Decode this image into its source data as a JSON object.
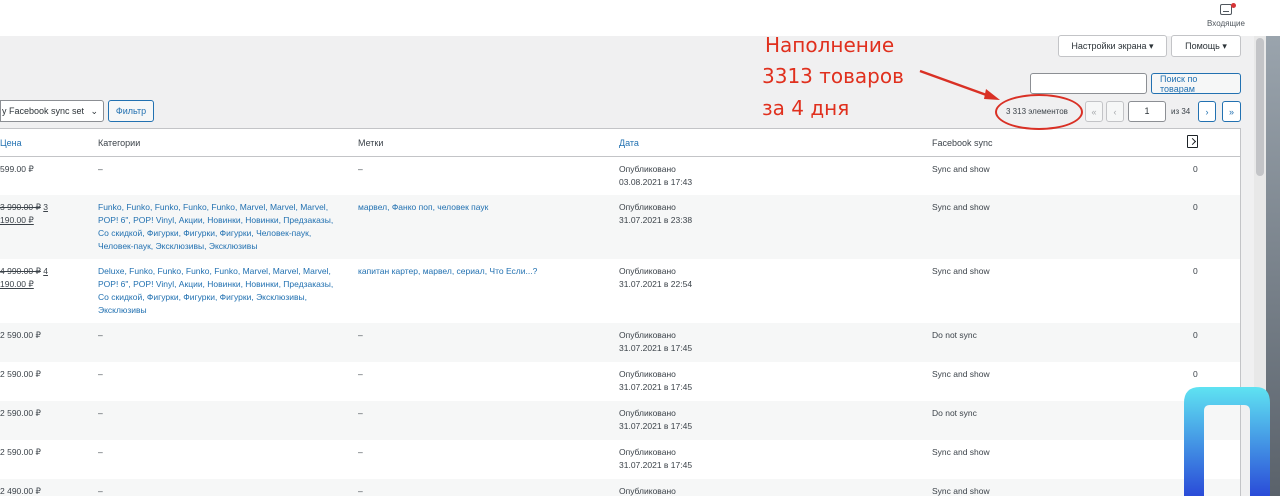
{
  "topbar": {
    "inbox_label": "Входящие"
  },
  "screen_options": {
    "settings_label": "Настройки экрана ▾",
    "help_label": "Помощь ▾"
  },
  "search": {
    "button_label": "Поиск по товарам",
    "value": ""
  },
  "filters": {
    "sync_select_value": "y Facebook sync set",
    "filter_button_label": "Фильтр"
  },
  "pagination": {
    "count_label": "3 313 элементов",
    "first": "«",
    "prev": "‹",
    "current_page": "1",
    "of_label": "из 34",
    "next": "›",
    "last": "»"
  },
  "annotation": {
    "line1": "Наполнение",
    "line2": "3313 товаров",
    "line3": "за 4 дня",
    "color": "#e0301e"
  },
  "table": {
    "headers": {
      "price": "Цена",
      "categories": "Категории",
      "tags": "Метки",
      "date": "Дата",
      "fb_sync": "Facebook sync"
    },
    "rows": [
      {
        "price_line1": "599.00 ₽",
        "price_line2": "",
        "categories": "–",
        "tags": "–",
        "date_status": "Опубликовано",
        "date_value": "03.08.2021 в 17:43",
        "fb": "Sync and show",
        "count": "0"
      },
      {
        "price_old": "3 990.00 ₽",
        "price_line1": "3",
        "price_line2": "190.00 ₽",
        "categories": [
          "Funko, Funko, Funko, Funko, Funko, Marvel, Marvel, Marvel,",
          "POP! 6\", POP! Vinyl, Акции, Новинки, Новинки, Предзаказы,",
          "Со скидкой, Фигурки, Фигурки, Фигурки, Человек-паук,",
          "Человек-паук, Эксклюзивы, Эксклюзивы"
        ],
        "tags": "марвел, Фанко поп, человек паук",
        "date_status": "Опубликовано",
        "date_value": "31.07.2021 в 23:38",
        "fb": "Sync and show",
        "count": "0"
      },
      {
        "price_old": "4 990.00 ₽",
        "price_line1": "4",
        "price_line2": "190.00 ₽",
        "categories": [
          "Deluxe, Funko, Funko, Funko, Funko, Marvel, Marvel, Marvel,",
          "POP! 6\", POP! Vinyl, Акции, Новинки, Новинки, Предзаказы,",
          "Со скидкой, Фигурки, Фигурки, Фигурки, Эксклюзивы,",
          "Эксклюзивы"
        ],
        "tags": "капитан картер, марвел, сериал, Что Если...?",
        "date_status": "Опубликовано",
        "date_value": "31.07.2021 в 22:54",
        "fb": "Sync and show",
        "count": "0"
      },
      {
        "price_line1": "2 590.00 ₽",
        "categories": "–",
        "tags": "–",
        "date_status": "Опубликовано",
        "date_value": "31.07.2021 в 17:45",
        "fb": "Do not sync",
        "count": "0"
      },
      {
        "price_line1": "2 590.00 ₽",
        "categories": "–",
        "tags": "–",
        "date_status": "Опубликовано",
        "date_value": "31.07.2021 в 17:45",
        "fb": "Sync and show",
        "count": "0"
      },
      {
        "price_line1": "2 590.00 ₽",
        "categories": "–",
        "tags": "–",
        "date_status": "Опубликовано",
        "date_value": "31.07.2021 в 17:45",
        "fb": "Do not sync",
        "count": "0"
      },
      {
        "price_line1": "2 590.00 ₽",
        "categories": "–",
        "tags": "–",
        "date_status": "Опубликовано",
        "date_value": "31.07.2021 в 17:45",
        "fb": "Sync and show",
        "count": "0"
      },
      {
        "price_line1": "2 490.00 ₽",
        "categories": "–",
        "tags": "–",
        "date_status": "Опубликовано",
        "date_value": "",
        "fb": "Sync and show",
        "count": "0"
      }
    ]
  }
}
